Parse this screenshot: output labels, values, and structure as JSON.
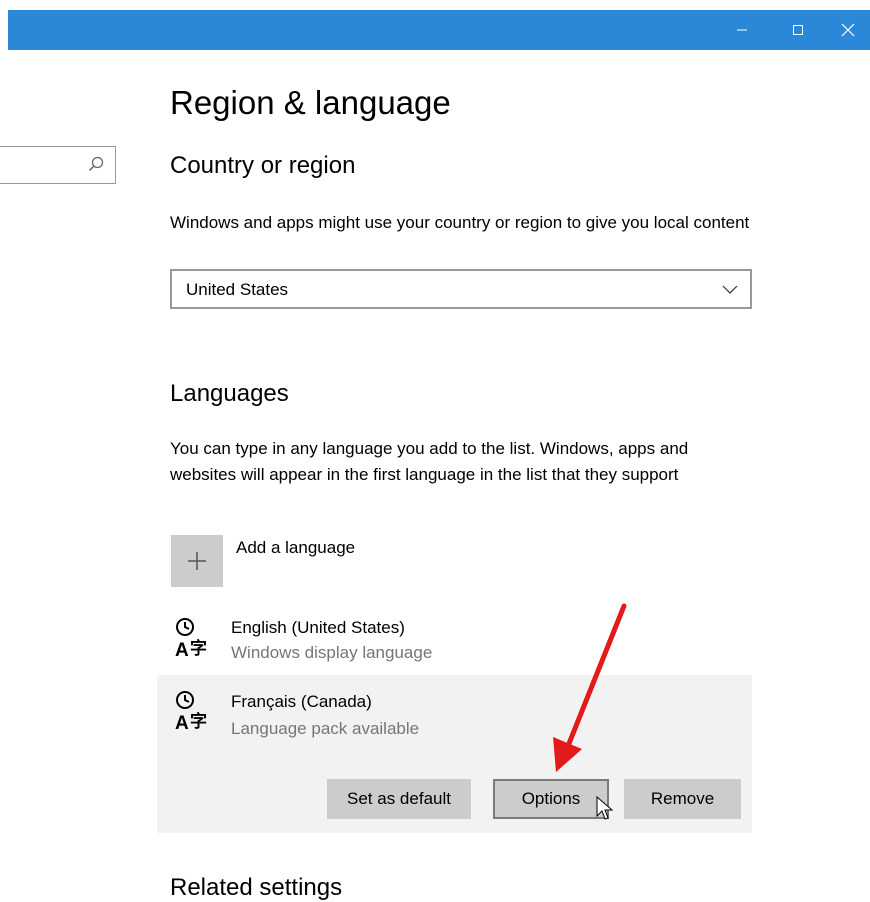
{
  "window": {
    "controls": {
      "minimize_icon": "minimize-icon",
      "maximize_icon": "maximize-icon",
      "close_icon": "close-icon"
    },
    "titlebar_color": "#2b88d8"
  },
  "search": {
    "placeholder": "",
    "icon": "search-icon"
  },
  "page": {
    "title": "Region & language"
  },
  "country": {
    "heading": "Country or region",
    "description": "Windows and apps might use your country or region to give you local content",
    "selected": "United States"
  },
  "languages": {
    "heading": "Languages",
    "description": "You can type in any language you add to the list. Windows, apps and websites will appear in the first language in the list that they support",
    "add_label": "Add a language",
    "items": [
      {
        "name": "English (United States)",
        "status": "Windows display language"
      },
      {
        "name": "Français (Canada)",
        "status": "Language pack available"
      }
    ],
    "buttons": {
      "set_default": "Set as default",
      "options": "Options",
      "remove": "Remove"
    }
  },
  "related": {
    "heading": "Related settings"
  },
  "annotation": {
    "arrow_color": "#e3191c"
  }
}
